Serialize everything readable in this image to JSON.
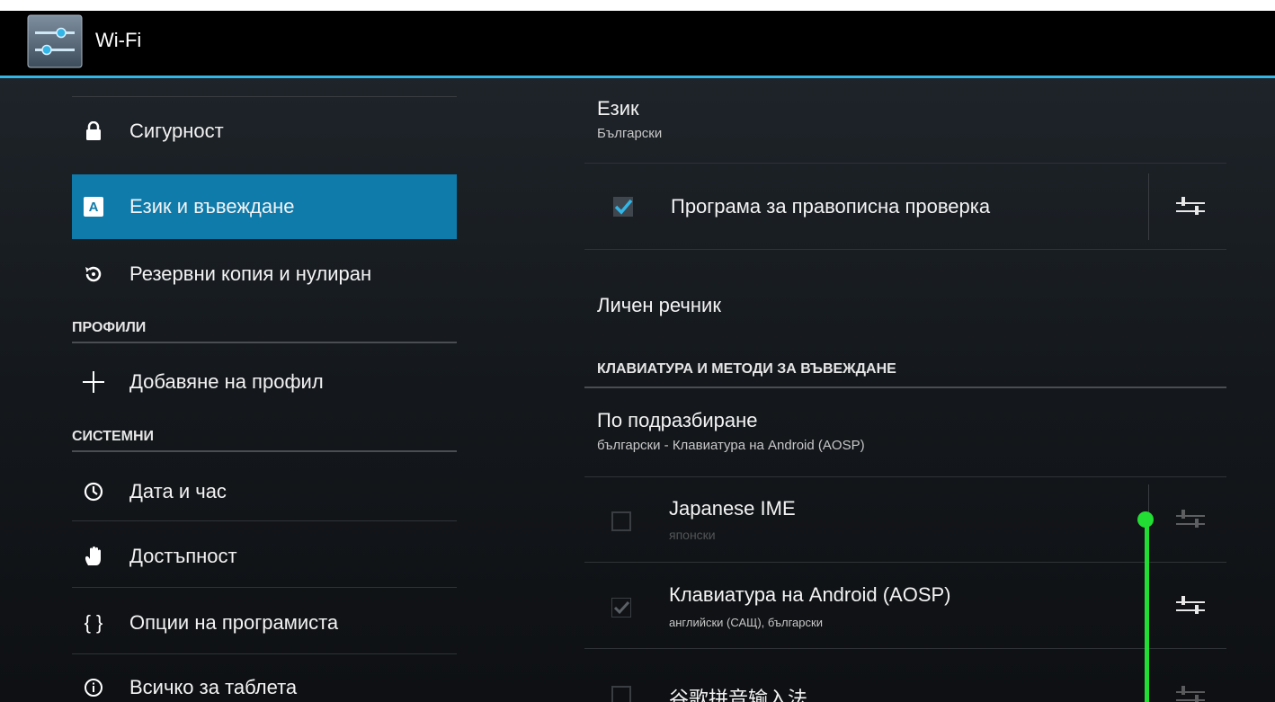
{
  "actionbar": {
    "title": "Wi-Fi",
    "icon": "settings-sliders-icon"
  },
  "sidebar": {
    "items": [
      {
        "label": "Сигурност",
        "icon": "lock-icon",
        "selected": false
      },
      {
        "label": "Език и въвеждане",
        "icon": "keyboard-a-icon",
        "selected": true
      },
      {
        "label": "Резервни копия и нулиран",
        "icon": "backup-restore-icon",
        "selected": false
      },
      {
        "label": "Добавяне на профил",
        "icon": "plus-icon",
        "selected": false
      },
      {
        "label": "Дата и час",
        "icon": "clock-icon",
        "selected": false
      },
      {
        "label": "Достъпност",
        "icon": "hand-icon",
        "selected": false
      },
      {
        "label": "Опции на програмиста",
        "icon": "braces-icon",
        "selected": false
      },
      {
        "label": "Всичко за таблета",
        "icon": "info-icon",
        "selected": false
      }
    ],
    "headers": {
      "profiles": "ПРОФИЛИ",
      "system": "СИСТЕМНИ"
    },
    "braces_glyph": "{ }"
  },
  "content": {
    "language": {
      "title": "Език",
      "value": "Български"
    },
    "spellcheck": {
      "label": "Програма за правописна проверка",
      "checked": true
    },
    "dictionary": {
      "title": "Личен речник"
    },
    "keyboard_header": "КЛАВИАТУРА И МЕТОДИ ЗА ВЪВЕЖДАНЕ",
    "default": {
      "title": "По подразбиране",
      "value": "български - Клавиатура на Android (AOSP)"
    },
    "imes": [
      {
        "title": "Japanese IME",
        "subtitle": "японски",
        "checked": false,
        "enabled": false
      },
      {
        "title": "Клавиатура на Android (AOSP)",
        "subtitle": "английски (САЩ), български",
        "checked": true,
        "enabled": true
      },
      {
        "title": "谷歌拼音输入法",
        "subtitle": "",
        "checked": false,
        "enabled": false
      }
    ]
  },
  "colors": {
    "accent": "#33b5e5",
    "selected": "#0f7bab",
    "drag_indicator": "#22dd33"
  }
}
